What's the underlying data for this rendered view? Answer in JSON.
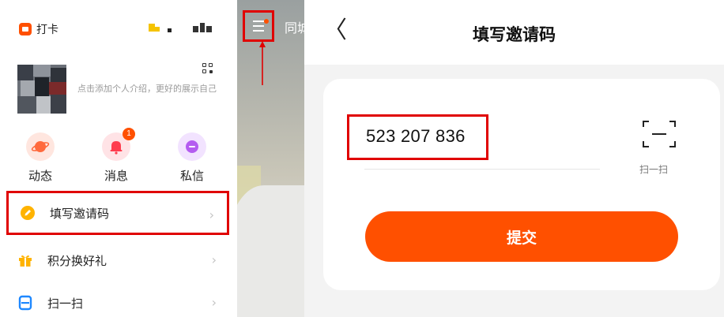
{
  "left_panel": {
    "checkin_label": "打卡",
    "profile_hint": "点击添加个人介绍，更好的展示自己",
    "actions": [
      {
        "label": "动态",
        "icon": "planet-icon",
        "color": "#ff6a3d"
      },
      {
        "label": "消息",
        "icon": "bell-icon",
        "color": "#ff3d4f",
        "badge": "1"
      },
      {
        "label": "私信",
        "icon": "chat-bubble-icon",
        "color": "#b45cf0"
      }
    ],
    "menu": [
      {
        "label": "填写邀请码",
        "icon": "pencil-icon",
        "highlighted": true
      },
      {
        "label": "积分换好礼",
        "icon": "gift-icon"
      },
      {
        "label": "扫一扫",
        "icon": "scan-icon"
      }
    ],
    "chevron": "›"
  },
  "middle_strip": {
    "menu_icon": "hamburger-icon",
    "partial_text": "同城"
  },
  "right_panel": {
    "back_glyph": "〈",
    "title": "填写邀请码",
    "invite_code": "523 207 836",
    "scan_label": "扫一扫",
    "submit_label": "提交"
  },
  "colors": {
    "accent": "#ff5000",
    "highlight_box": "#e00000"
  }
}
